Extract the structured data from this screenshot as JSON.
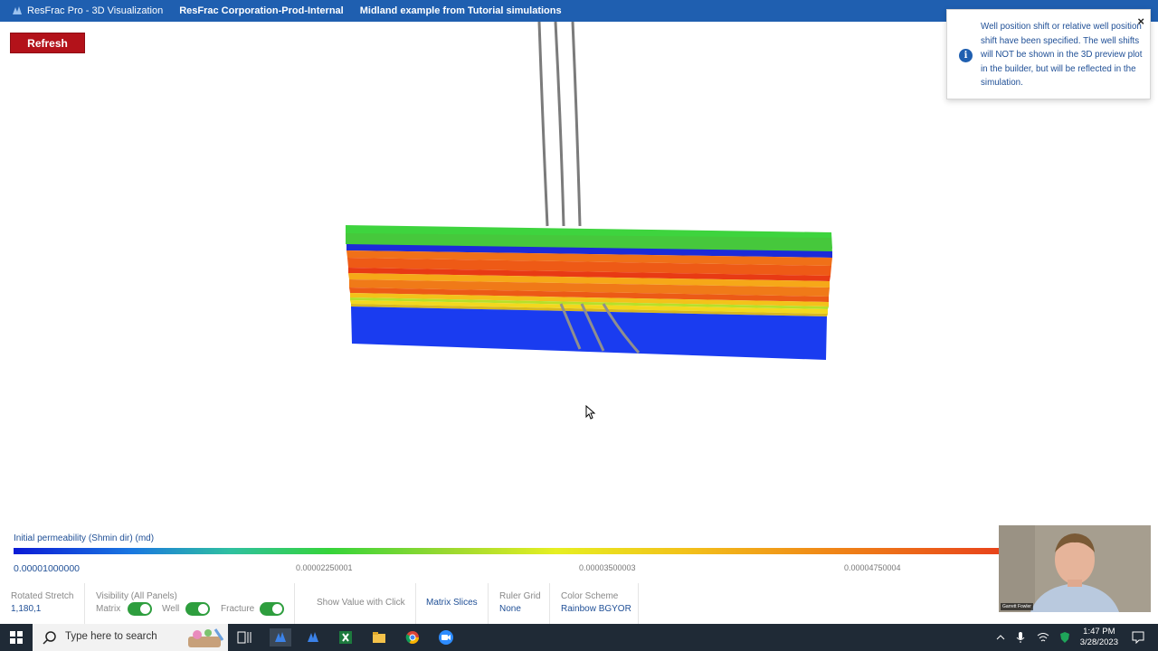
{
  "titlebar": {
    "app_title": "ResFrac Pro - 3D Visualization",
    "org": "ResFrac Corporation-Prod-Internal",
    "project": "Midland example from Tutorial simulations"
  },
  "refresh_label": "Refresh",
  "notification": {
    "text": "Well position shift or relative well position shift have been specified. The well shifts will NOT be shown in the 3D preview plot in the builder, but will be reflected in the simulation.",
    "close_symbol": "×",
    "info_symbol": "i"
  },
  "colorscale": {
    "title": "Initial permeability (Shmin dir) (md)",
    "ticks": [
      "0.00001000000",
      "0.00002250001",
      "0.00003500003",
      "0.00004750004"
    ],
    "colors": [
      "#0a1ad6",
      "#35d43a",
      "#e6ef22",
      "#f08a18",
      "#e8431a"
    ]
  },
  "toolbar": {
    "rotated_stretch_label": "Rotated Stretch",
    "rotated_stretch_value": "1,180,1",
    "visibility_label": "Visibility (All Panels)",
    "matrix_label": "Matrix",
    "well_label": "Well",
    "fracture_label": "Fracture",
    "show_value_label": "Show Value with Click",
    "matrix_slices_label": "Matrix Slices",
    "ruler_grid_label": "Ruler Grid",
    "ruler_grid_value": "None",
    "color_scheme_label": "Color Scheme",
    "color_scheme_value": "Rainbow BGYOR",
    "toggles": {
      "matrix": true,
      "well": true,
      "fracture": true
    }
  },
  "webcam": {
    "name_tag": "Garrett Fowler"
  },
  "taskbar": {
    "search_placeholder": "Type here to search",
    "time": "1:47 PM",
    "date": "3/28/2023",
    "pinned_apps": [
      "task-view-icon",
      "resfrac-icon",
      "resfrac-icon",
      "excel-icon",
      "file-explorer-icon",
      "chrome-icon",
      "zoom-icon"
    ]
  },
  "colors": {
    "accent": "#1f5fb0",
    "refresh": "#b3121a",
    "toggle_on": "#2e9e3e"
  }
}
